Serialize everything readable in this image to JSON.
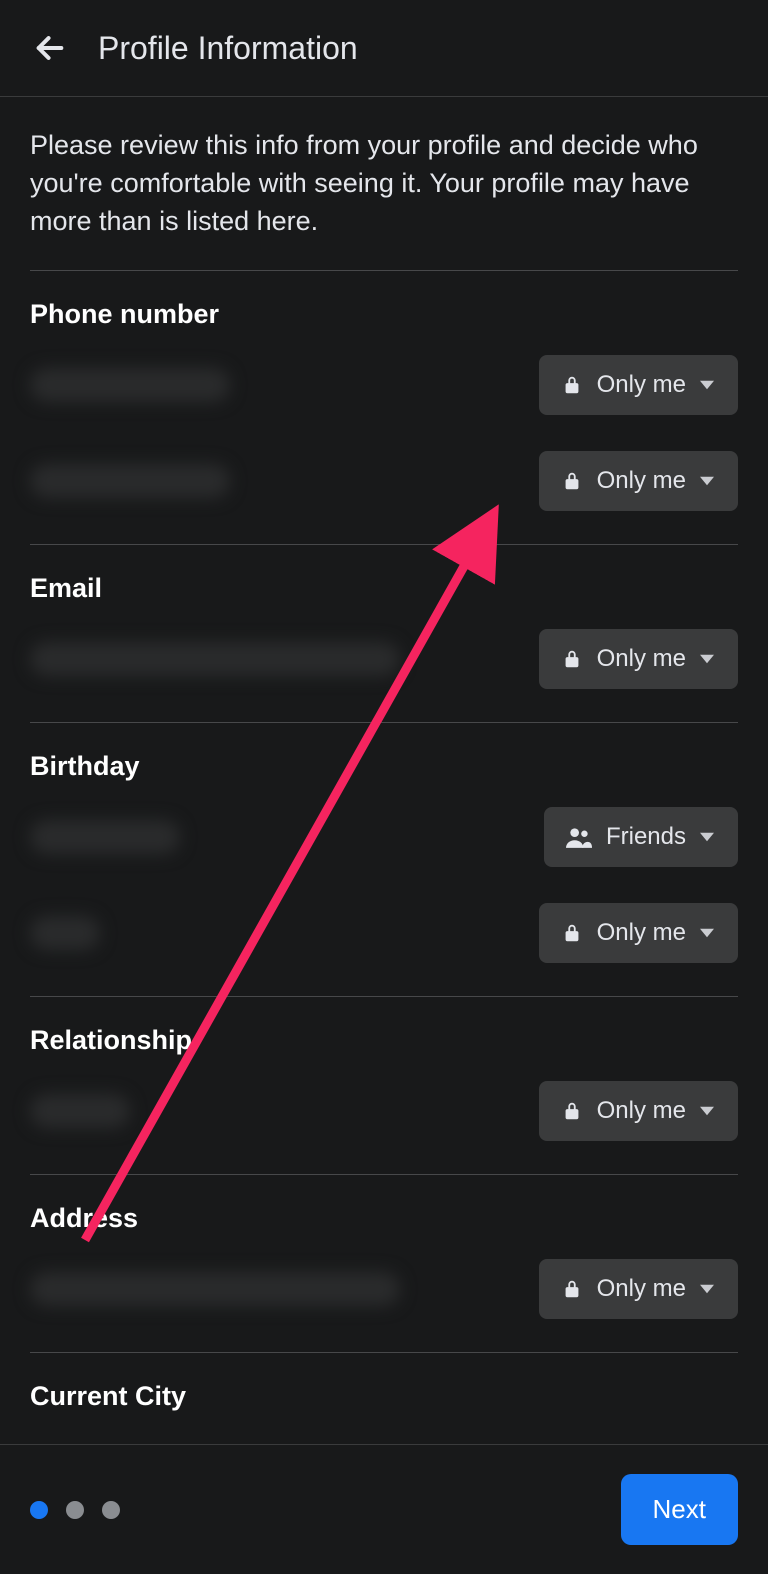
{
  "header": {
    "title": "Profile Information"
  },
  "intro": "Please review this info from your profile and decide who you're comfortable with seeing it. Your profile may have more than is listed here.",
  "privacy_options": {
    "only_me": "Only me",
    "friends": "Friends"
  },
  "sections": {
    "phone": {
      "title": "Phone number",
      "rows": [
        {
          "value_width": 200,
          "privacy": "only_me"
        },
        {
          "value_width": 200,
          "privacy": "only_me"
        }
      ]
    },
    "email": {
      "title": "Email",
      "rows": [
        {
          "value_width": 370,
          "privacy": "only_me"
        }
      ]
    },
    "birthday": {
      "title": "Birthday",
      "rows": [
        {
          "value_width": 150,
          "privacy": "friends"
        },
        {
          "value_width": 70,
          "privacy": "only_me"
        }
      ]
    },
    "relationship": {
      "title": "Relationship",
      "rows": [
        {
          "value_width": 100,
          "privacy": "only_me"
        }
      ]
    },
    "address": {
      "title": "Address",
      "rows": [
        {
          "value_width": 370,
          "privacy": "only_me"
        }
      ]
    },
    "current_city": {
      "title": "Current City",
      "rows": []
    }
  },
  "footer": {
    "next": "Next",
    "progress_total": 3,
    "progress_active": 0
  },
  "annotation": {
    "arrow_color": "#f5245f"
  }
}
